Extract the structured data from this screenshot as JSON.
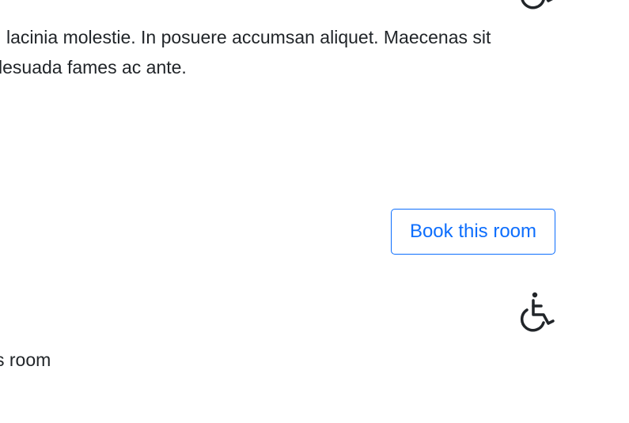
{
  "room1": {
    "description_line1": "lacinia molestie. In posuere accumsan aliquet. Maecenas sit",
    "description_line2": "lesuada fames ac ante.",
    "accessibility_icon": "wheelchair-icon",
    "book_label": "Book this room"
  },
  "room2": {
    "accessibility_icon": "wheelchair-icon",
    "description": "s room"
  },
  "colors": {
    "primary": "#0d6efd",
    "text": "#212529",
    "background": "#ffffff"
  }
}
